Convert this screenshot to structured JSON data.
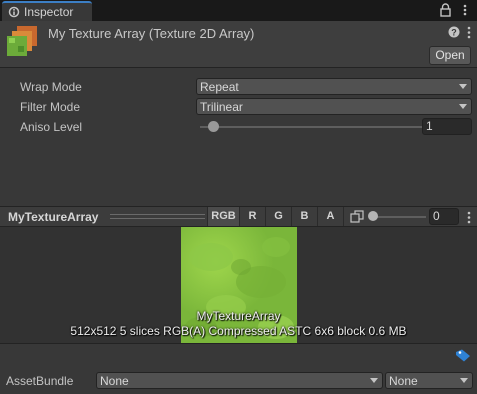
{
  "tab": {
    "label": "Inspector"
  },
  "header": {
    "title": "My Texture Array (Texture 2D Array)",
    "open_label": "Open"
  },
  "properties": {
    "wrap_mode": {
      "label": "Wrap Mode",
      "value": "Repeat"
    },
    "filter_mode": {
      "label": "Filter Mode",
      "value": "Trilinear"
    },
    "aniso_level": {
      "label": "Aniso Level",
      "value": "1",
      "slider_fraction": 0.0625
    }
  },
  "preview": {
    "title": "MyTextureArray",
    "channels": [
      "RGB",
      "R",
      "G",
      "B",
      "A"
    ],
    "active_channel": "RGB",
    "mip_value": "0",
    "texture_name": "MyTextureArray",
    "texture_info": "512x512 5 slices RGB(A) Compressed ASTC 6x6 block 0.6 MB"
  },
  "asset_bundle": {
    "label": "AssetBundle",
    "name_value": "None",
    "variant_value": "None"
  },
  "colors": {
    "accent": "#3c7fc5",
    "panel": "#383838",
    "texture_green": "#8cc63f"
  },
  "icons": [
    "inspector-icon",
    "lock-icon",
    "kebab-menu-icon",
    "help-icon",
    "mip-icon",
    "label-tag-icon"
  ]
}
